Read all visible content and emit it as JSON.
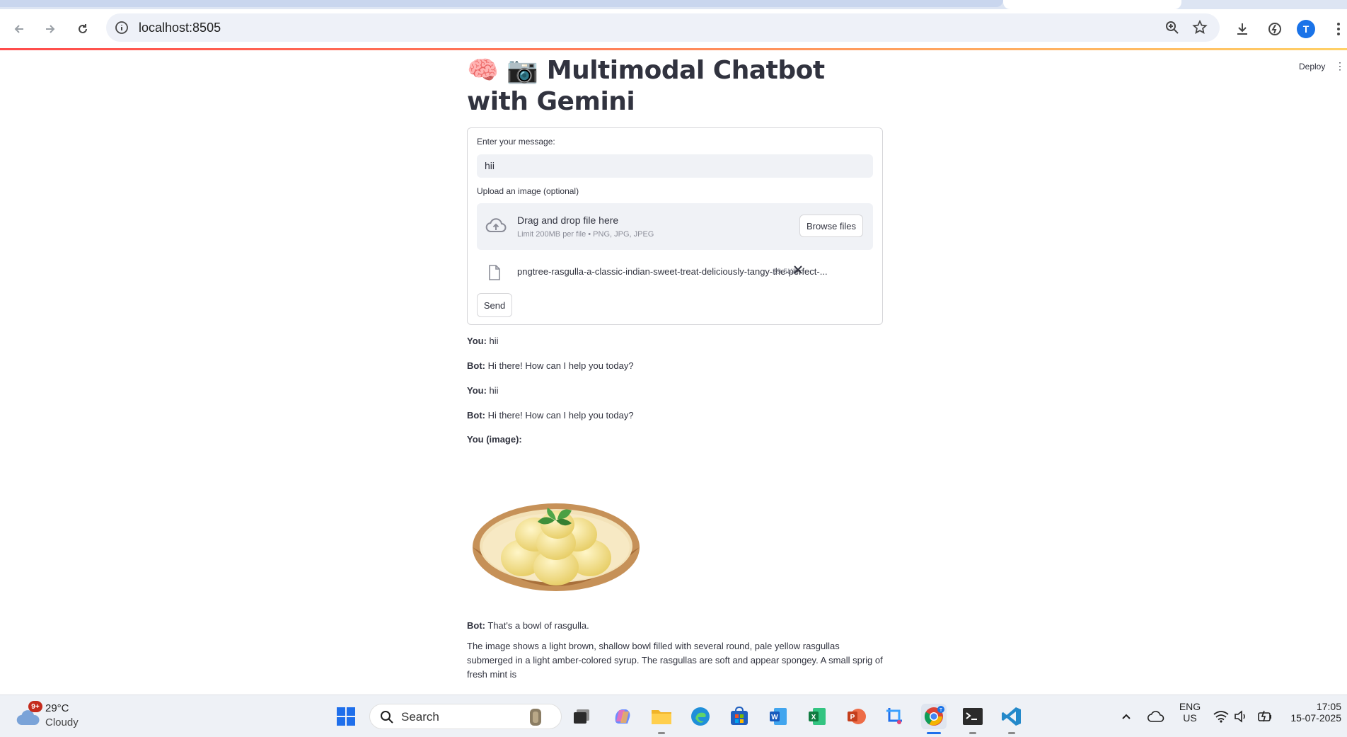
{
  "browser": {
    "url": "localhost:8505",
    "avatar_letter": "T"
  },
  "header": {
    "deploy_label": "Deploy",
    "menu_glyph": "⋮"
  },
  "page": {
    "title_emoji_1": "🧠",
    "title_emoji_2": "📷",
    "title": "Multimodal Chatbot with Gemini"
  },
  "form": {
    "message_label": "Enter your message:",
    "message_value": "hii",
    "upload_label": "Upload an image (optional)",
    "dropzone_title": "Drag and drop file here",
    "dropzone_limit": "Limit 200MB per file • PNG, JPG, JPEG",
    "browse_label": "Browse files",
    "uploaded_file": {
      "name": "pngtree-rasgulla-a-classic-indian-sweet-treat-deliciously-tangy-the-perfect-...",
      "size": "29.5KB"
    },
    "send_label": "Send"
  },
  "chat": {
    "messages": [
      {
        "speaker": "You:",
        "text": " hii"
      },
      {
        "speaker": "Bot:",
        "text": " Hi there! How can I help you today?"
      },
      {
        "speaker": "You:",
        "text": " hii"
      },
      {
        "speaker": "Bot:",
        "text": " Hi there! How can I help you today?"
      },
      {
        "speaker": "You (image):",
        "text": ""
      },
      {
        "speaker": "Bot:",
        "text": " That's a bowl of rasgulla."
      }
    ],
    "description": "The image shows a light brown, shallow bowl filled with several round, pale yellow rasgullas submerged in a light amber-colored syrup. The rasgullas are soft and appear spongey. A small sprig of fresh mint is"
  },
  "taskbar": {
    "weather_temp": "29°C",
    "weather_cond": "Cloudy",
    "weather_badge": "9+",
    "search_label": "Search",
    "lang_top": "ENG",
    "lang_bottom": "US",
    "time": "17:05",
    "date": "15-07-2025",
    "icons": [
      "start-icon",
      "search-icon",
      "task-view-icon",
      "copilot-icon",
      "file-explorer-icon",
      "edge-icon",
      "store-icon",
      "word-icon",
      "excel-icon",
      "powerpoint-icon",
      "snipping-tool-icon",
      "chrome-icon",
      "terminal-icon",
      "vscode-icon"
    ]
  },
  "colors": {
    "accent": "#ff4b4b",
    "text": "#31333f",
    "input_bg": "#f0f2f6"
  }
}
